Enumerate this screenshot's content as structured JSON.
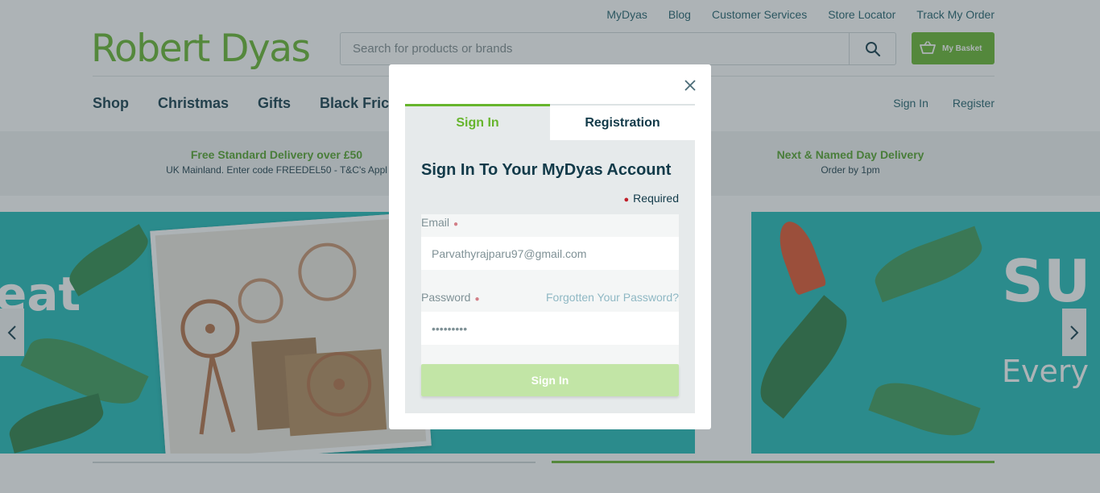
{
  "top_nav": [
    "MyDyas",
    "Blog",
    "Customer Services",
    "Store Locator",
    "Track My Order"
  ],
  "logo": "Robert Dyas",
  "search": {
    "placeholder": "Search for products or brands",
    "icon": "search-icon"
  },
  "basket": {
    "label": "My Basket",
    "icon": "basket-icon"
  },
  "main_nav": [
    "Shop",
    "Christmas",
    "Gifts",
    "Black Fric"
  ],
  "account_links": {
    "sign_in": "Sign In",
    "register": "Register"
  },
  "promos": [
    {
      "title": "Free Standard Delivery over £50",
      "subtitle": "UK Mainland. Enter code FREEDEL50 - T&C's Appl"
    },
    {
      "title": "Next & Named Day Delivery",
      "subtitle": "Order by 1pm"
    }
  ],
  "banners": {
    "left_text": "eat",
    "right_text_1": "SU",
    "right_text_2": "Every"
  },
  "modal": {
    "close_icon": "close-icon",
    "tabs": [
      {
        "label": "Sign In",
        "active": true
      },
      {
        "label": "Registration",
        "active": false
      }
    ],
    "heading": "Sign In To Your MyDyas Account",
    "required_label": "Required",
    "email_label": "Email",
    "email_value": "Parvathyrajparu97@gmail.com",
    "password_label": "Password",
    "forgot_label": "Forgotten Your Password?",
    "password_value": "•••••••••",
    "submit_label": "Sign In"
  },
  "colors": {
    "brand_green": "#67b52d",
    "nav_text": "#123a49",
    "banner_teal": "#1fbab7",
    "button_disabled": "#c2e5a6"
  }
}
